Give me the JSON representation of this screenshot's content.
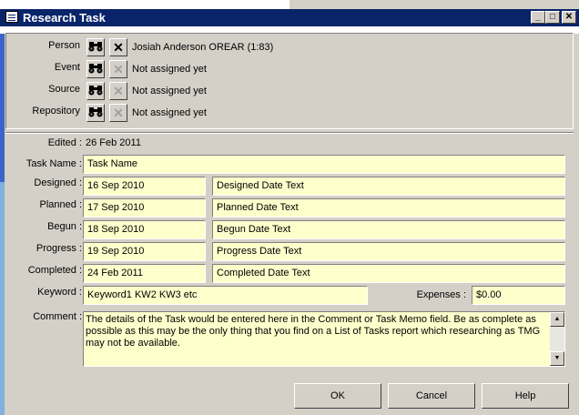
{
  "window": {
    "title": "Research Task",
    "minimize_glyph": "_",
    "maximize_glyph": "□",
    "close_glyph": "✕"
  },
  "assignments": [
    {
      "label": "Person",
      "value": "Josiah Anderson OREAR (1:83)",
      "clear_enabled": true
    },
    {
      "label": "Event",
      "value": "Not assigned yet",
      "clear_enabled": false
    },
    {
      "label": "Source",
      "value": "Not assigned yet",
      "clear_enabled": false
    },
    {
      "label": "Repository",
      "value": "Not assigned yet",
      "clear_enabled": false
    }
  ],
  "edited": {
    "label": "Edited :",
    "value": "26 Feb 2011"
  },
  "task_name": {
    "label": "Task Name :",
    "value": "Task Name"
  },
  "dates": [
    {
      "label": "Designed :",
      "date": "16 Sep 2010",
      "text": "Designed Date Text"
    },
    {
      "label": "Planned :",
      "date": "17 Sep 2010",
      "text": "Planned Date Text"
    },
    {
      "label": "Begun :",
      "date": "18 Sep 2010",
      "text": "Begun Date Text"
    },
    {
      "label": "Progress :",
      "date": "19 Sep 2010",
      "text": "Progress Date Text"
    },
    {
      "label": "Completed :",
      "date": "24 Feb 2011",
      "text": "Completed Date Text"
    }
  ],
  "keyword": {
    "label": "Keyword :",
    "value": "Keyword1 KW2 KW3 etc"
  },
  "expenses": {
    "label": "Expenses :",
    "value": "$0.00"
  },
  "comment": {
    "label": "Comment :",
    "value": "The details of the Task would be entered here in the Comment or Task Memo field.  Be as complete as possible as this may be the only thing that you find on a List of Tasks report which researching as TMG may not be available."
  },
  "buttons": {
    "ok": "OK",
    "cancel": "Cancel",
    "help": "Help"
  },
  "icons": {
    "find": "binoculars-icon",
    "clear": "clear-x-icon"
  }
}
